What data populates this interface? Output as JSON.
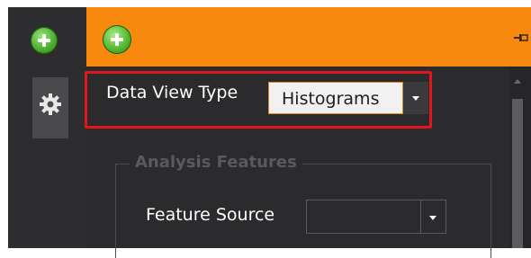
{
  "data_view": {
    "label": "Data View Type",
    "selected": "Histograms"
  },
  "analysis_features": {
    "title": "Analysis Features",
    "feature_source_label": "Feature Source",
    "feature_source_value": ""
  },
  "colors": {
    "header": "#f7890f",
    "highlight": "#e0161c",
    "background": "#2d2d2f"
  },
  "icons": [
    "add-icon",
    "settings-gear-icon",
    "add-icon",
    "pin-icon",
    "chevron-down-icon",
    "scroll-up-icon"
  ]
}
